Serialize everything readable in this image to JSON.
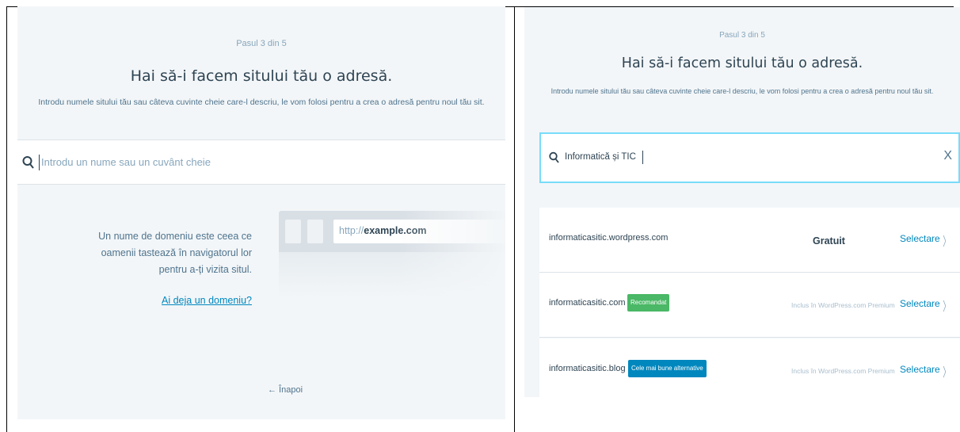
{
  "left": {
    "step": "Pasul 3 din 5",
    "title": "Hai să-i facem sitului tău o adresă.",
    "subtitle": "Introdu numele sitului tău sau câteva cuvinte cheie care-l descriu, le vom folosi pentru a crea o adresă pentru noul tău sit.",
    "search": {
      "placeholder": "Introdu un nume sau un cuvânt cheie",
      "icon": "search-icon"
    },
    "explanation_lines": [
      "Un nume de domeniu este ceea ce",
      "oamenii tastează în navigatorul lor",
      "pentru a-ți vizita situl."
    ],
    "have_domain_link": "Ai deja un domeniu?",
    "illustration": {
      "url_prefix": "http://",
      "url_domain": "example.com"
    },
    "back_label": "← Înapoi"
  },
  "right": {
    "step": "Pasul 3 din 5",
    "title": "Hai să-i facem sitului tău o adresă.",
    "subtitle": "Introdu numele sitului tău sau câteva cuvinte cheie care-l descriu, le vom folosi pentru a crea o adresă pentru noul tău sit.",
    "search": {
      "value": "Informatică și TIC",
      "clear_label": "X",
      "icon": "search-icon"
    },
    "results": [
      {
        "domain": "informaticasitic.wordpress.com",
        "badge": "",
        "price": "Gratuit",
        "included": "",
        "select": "Selectare"
      },
      {
        "domain": "informaticasitic.com",
        "badge": "Recomandat",
        "badge_color": "#4ab866",
        "price": "",
        "included": "Inclus în WordPress.com Premium",
        "select": "Selectare"
      },
      {
        "domain": "informaticasitic.blog",
        "badge": "Cele mai bune alternative",
        "badge_color": "#0087be",
        "price": "",
        "included": "Inclus în WordPress.com Premium",
        "select": "Selectare"
      }
    ]
  },
  "colors": {
    "accent": "#0087be",
    "panel_bg": "#f3f6f8",
    "text": "#2e4453",
    "focus_border": "#78dcfa"
  }
}
